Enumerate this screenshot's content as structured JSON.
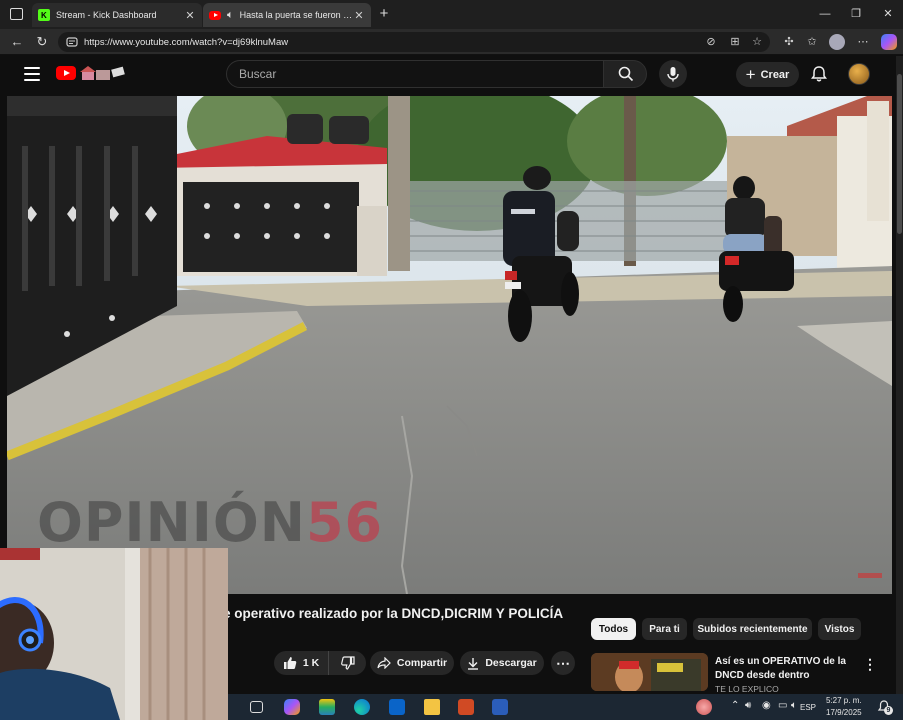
{
  "browser": {
    "tabs": [
      {
        "title": "Stream - Kick Dashboard",
        "favicon": "kick-icon"
      },
      {
        "title": "Hasta la puerta se fueron en",
        "favicon": "youtube-icon"
      }
    ],
    "url": "https://www.youtube.com/watch?v=dj69klnuMaw"
  },
  "youtube": {
    "search_placeholder": "Buscar",
    "create_label": "Crear",
    "watermark_left": "OPINIÓN",
    "watermark_right": "56",
    "video_title": "e operativo realizado por la DNCD,DICRIM Y POLICÍA",
    "like_count": "1 K",
    "share_label": "Compartir",
    "download_label": "Descargar",
    "chips": [
      "Todos",
      "Para ti",
      "Subidos recientemente",
      "Vistos"
    ],
    "recommendation": {
      "title": "Así es un OPERATIVO de la DNCD desde dentro",
      "channel": "TE LO EXPLICO"
    }
  },
  "taskbar": {
    "language": "ESP",
    "time": "5:27 p. m.",
    "date": "17/9/2025",
    "notification_count": "9"
  },
  "colors": {
    "youtube_red": "#ff0000",
    "kick_green": "#53fc18",
    "taskbar_bg": "#1c2733"
  }
}
